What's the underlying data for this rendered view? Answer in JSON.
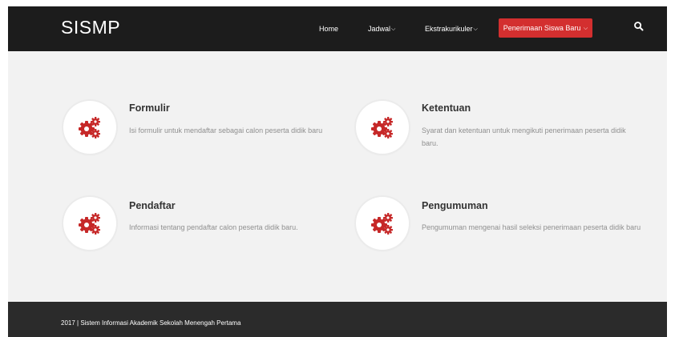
{
  "navbar": {
    "brand": "SISMP",
    "items": [
      {
        "label": "Home",
        "has_dropdown": false
      },
      {
        "label": "Jadwal",
        "has_dropdown": true
      },
      {
        "label": "Ekstrakurikuler",
        "has_dropdown": true
      }
    ],
    "cta": {
      "label": "Penerimaan Siswa Baru",
      "has_dropdown": true,
      "color": "#d32f2f"
    },
    "search_icon": "search-icon",
    "background": "#1c1c1c"
  },
  "features": [
    {
      "icon": "gears-icon",
      "title": "Formulir",
      "description": "Isi formulir untuk mendaftar sebagai calon peserta didik baru"
    },
    {
      "icon": "gears-icon",
      "title": "Ketentuan",
      "description": "Syarat dan ketentuan untuk mengikuti penerimaan peserta didik baru."
    },
    {
      "icon": "gears-icon",
      "title": "Pendaftar",
      "description": "Informasi tentang pendaftar calon peserta didik baru."
    },
    {
      "icon": "gears-icon",
      "title": "Pengumuman",
      "description": "Pengumuman mengenai hasil seleksi penerimaan peserta didik baru"
    }
  ],
  "footer": {
    "text": "2017 | Sistem Informasi Akademik Sekolah Menengah Pertama"
  },
  "colors": {
    "accent": "#d32f2f",
    "page_background": "#f2f2f2",
    "footer_background": "#2b2b2b"
  }
}
